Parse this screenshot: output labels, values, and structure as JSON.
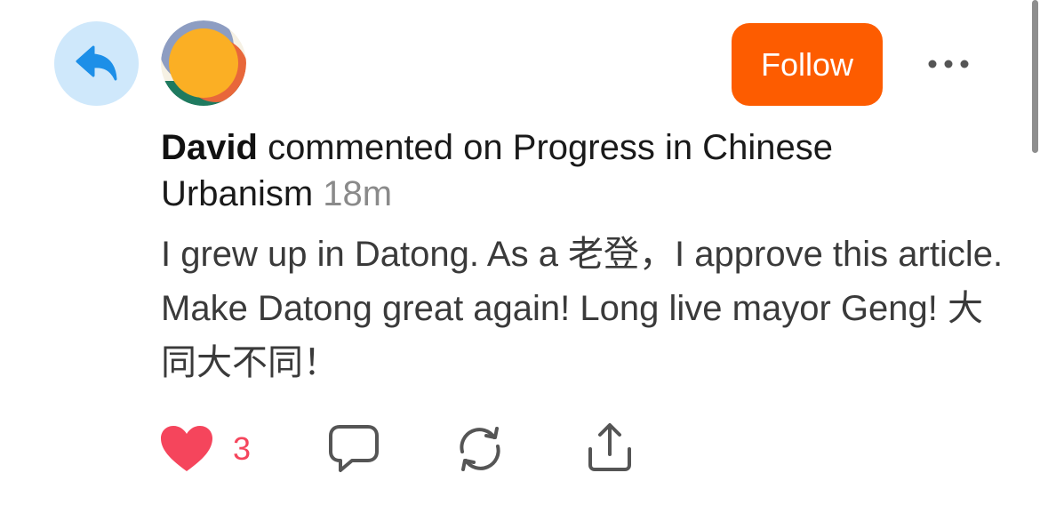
{
  "reply_badge": {
    "icon": "reply-arrow-icon",
    "color": "#1d8fe8"
  },
  "avatar": {
    "description": "user-avatar"
  },
  "follow_button": {
    "label": "Follow",
    "color": "#fd5c00"
  },
  "more_button": {
    "icon": "ellipsis-icon"
  },
  "header": {
    "author": "David",
    "action_text": "commented on Progress in Chinese Urbanism",
    "timestamp": "18m"
  },
  "comment": {
    "text": "I grew up in Datong. As a 老登，I approve this article. Make Datong great again! Long live mayor Geng! 大同大不同！"
  },
  "actions": {
    "like": {
      "icon": "heart-icon",
      "count": "3",
      "color": "#f5455c"
    },
    "comment": {
      "icon": "comment-bubble-icon"
    },
    "repost": {
      "icon": "repost-icon"
    },
    "share": {
      "icon": "share-icon"
    }
  }
}
